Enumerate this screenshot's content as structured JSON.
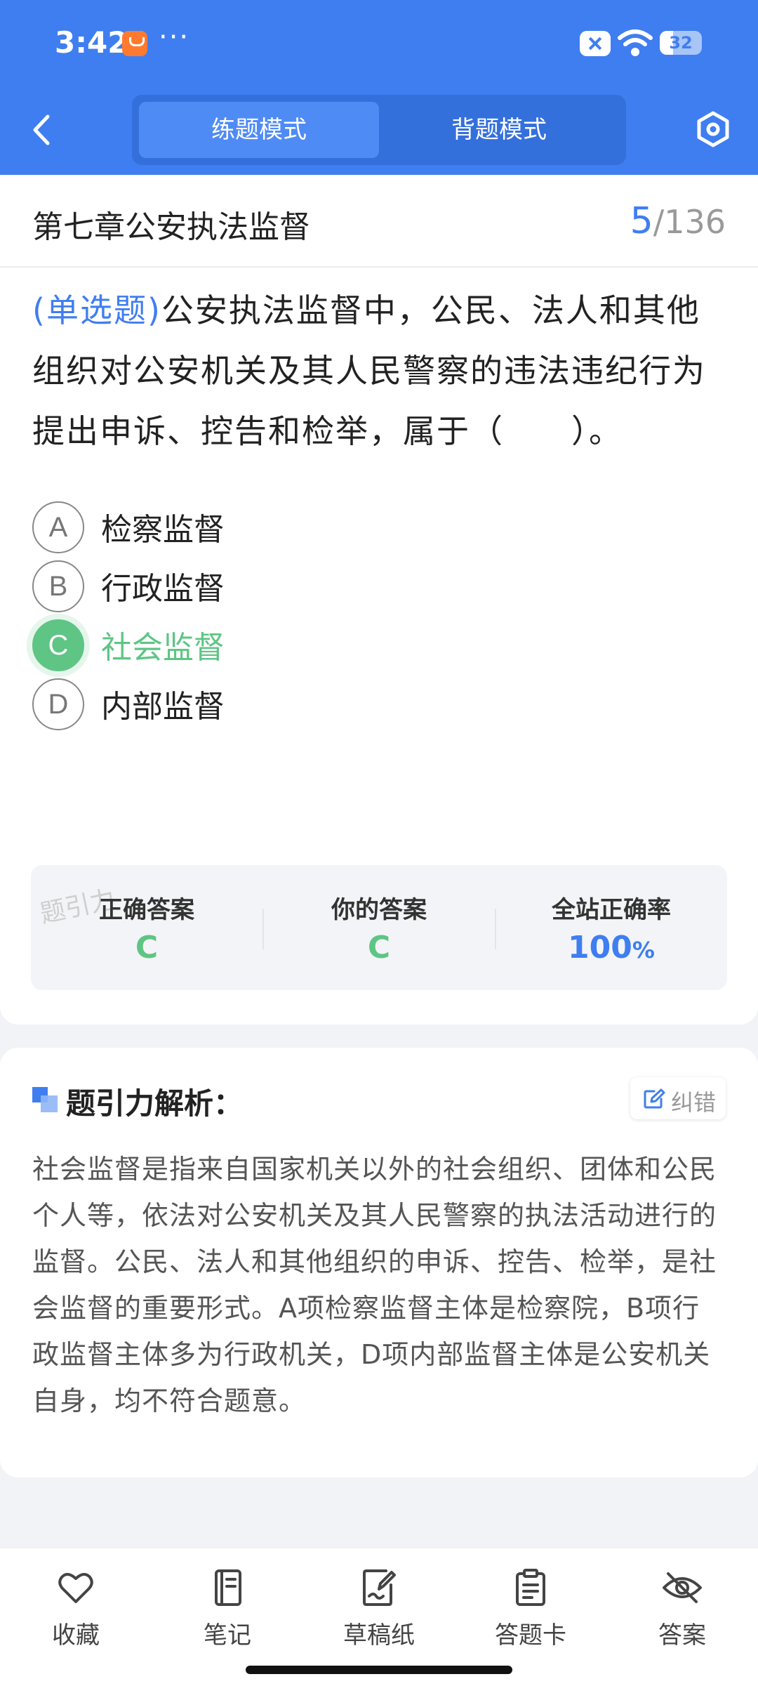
{
  "status_bar": {
    "time": "3:42",
    "battery": "32"
  },
  "header": {
    "tabs": [
      {
        "label": "练题模式",
        "active": true
      },
      {
        "label": "背题模式",
        "active": false
      }
    ]
  },
  "question_card": {
    "chapter": "第七章公安执法监督",
    "progress": {
      "current": "5",
      "separator": "/",
      "total": "136"
    },
    "question_type": "(单选题)",
    "question_text": "公安执法监督中，公民、法人和其他组织对公安机关及其人民警察的违法违纪行为提出申诉、控告和检举，属于（　　）。",
    "options": [
      {
        "letter": "A",
        "text": "检察监督",
        "state": "normal"
      },
      {
        "letter": "B",
        "text": "行政监督",
        "state": "normal"
      },
      {
        "letter": "C",
        "text": "社会监督",
        "state": "correct"
      },
      {
        "letter": "D",
        "text": "内部监督",
        "state": "normal"
      }
    ],
    "stats": {
      "correct_answer_label": "正确答案",
      "correct_answer": "C",
      "your_answer_label": "你的答案",
      "your_answer": "C",
      "accuracy_label": "全站正确率",
      "accuracy_value": "100",
      "accuracy_unit": "%"
    },
    "watermark": "题引力"
  },
  "analysis": {
    "title": "题引力解析：",
    "report_label": "纠错",
    "text": "社会监督是指来自国家机关以外的社会组织、团体和公民个人等，依法对公安机关及其人民警察的执法活动进行的监督。公民、法人和其他组织的申诉、控告、检举，是社会监督的重要形式。A项检察监督主体是检察院，B项行政监督主体多为行政机关，D项内部监督主体是公安机关自身，均不符合题意。"
  },
  "bottom_nav": [
    {
      "label": "收藏",
      "icon": "heart-icon"
    },
    {
      "label": "笔记",
      "icon": "notebook-icon"
    },
    {
      "label": "草稿纸",
      "icon": "draft-paper-icon"
    },
    {
      "label": "答题卡",
      "icon": "answer-sheet-icon"
    },
    {
      "label": "答案",
      "icon": "eye-off-icon"
    }
  ],
  "colors": {
    "primary": "#3f7ef0",
    "correct": "#5ec584",
    "background": "#f2f3f6"
  }
}
